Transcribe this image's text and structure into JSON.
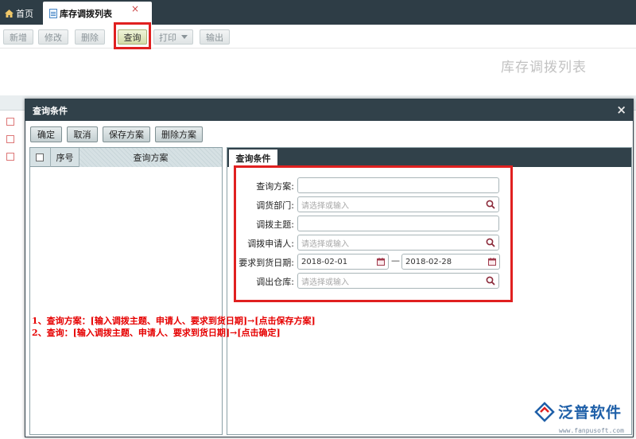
{
  "tabs": {
    "home_label": "首页",
    "active_label": "库存调拨列表",
    "close_glyph": "×"
  },
  "toolbar": {
    "new_label": "新增",
    "edit_label": "修改",
    "delete_label": "删除",
    "query_label": "查询",
    "print_label": "打印",
    "export_label": "输出"
  },
  "page_title": "库存调拨列表",
  "modal": {
    "title": "查询条件",
    "close_glyph": "×",
    "confirm_label": "确定",
    "cancel_label": "取消",
    "save_plan_label": "保存方案",
    "delete_plan_label": "删除方案",
    "plan_table": {
      "col_index": "序号",
      "col_plan": "查询方案"
    },
    "condition_tab": "查询条件",
    "fields": {
      "plan_label": "查询方案:",
      "plan_value": "",
      "dept_label": "调货部门:",
      "dept_placeholder": "请选择或输入",
      "subject_label": "调拨主题:",
      "subject_value": "",
      "applicant_label": "调拨申请人:",
      "applicant_placeholder": "请选择或输入",
      "date_label": "要求到货日期:",
      "date_from": "2018-02-01",
      "date_sep": "—",
      "date_to": "2018-02-28",
      "warehouse_label": "调出仓库:",
      "warehouse_placeholder": "请选择或输入"
    }
  },
  "notes": {
    "line1": "1、查询方案：[输入调拨主题、申请人、要求到货日期]→[点击保存方案]",
    "line2": "2、查询：[输入调拨主题、申请人、要求到货日期]→[点击确定]"
  },
  "brand": {
    "name": "泛普软件",
    "url": "www.fanpusoft.com"
  },
  "colors": {
    "header_bg": "#2e3d46",
    "highlight": "#e02020",
    "note_text": "#e60000",
    "brand_blue": "#1e5fa8"
  },
  "icons": {
    "home": "home-icon",
    "doc": "document-icon",
    "search": "search-icon",
    "calendar": "calendar-icon",
    "close": "close-icon"
  }
}
